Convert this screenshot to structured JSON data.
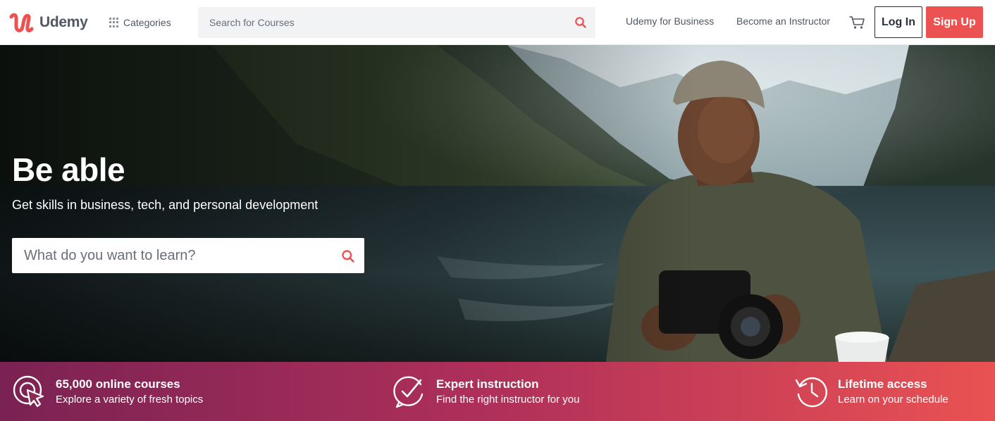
{
  "brand": {
    "logo_text": "Udemy",
    "accent": "#ec5252"
  },
  "header": {
    "categories_label": "Categories",
    "search_placeholder": "Search for Courses",
    "business_link": "Udemy for Business",
    "instructor_link": "Become an Instructor",
    "login_label": "Log In",
    "signup_label": "Sign Up"
  },
  "hero": {
    "title": "Be able",
    "subtitle": "Get skills in business, tech, and personal development",
    "search_placeholder": "What do you want to learn?"
  },
  "features": [
    {
      "icon": "target-cursor-icon",
      "title": "65,000 online courses",
      "subtitle": "Explore a variety of fresh topics"
    },
    {
      "icon": "check-bubble-icon",
      "title": "Expert instruction",
      "subtitle": "Find the right instructor for you"
    },
    {
      "icon": "clock-rewind-icon",
      "title": "Lifetime access",
      "subtitle": "Learn on your schedule"
    }
  ]
}
